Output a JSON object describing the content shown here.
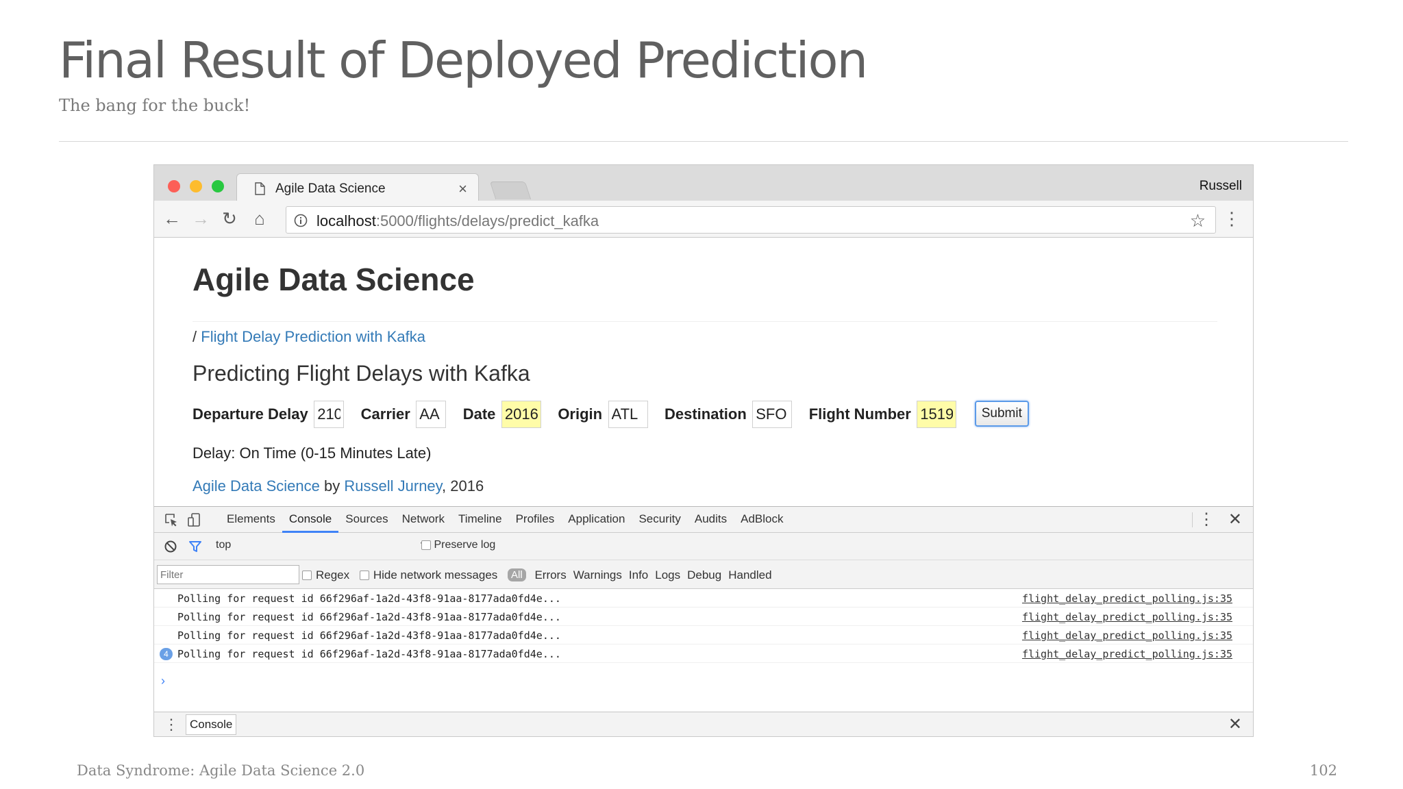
{
  "slide": {
    "title": "Final Result of Deployed Prediction",
    "subtitle": "The bang for the buck!",
    "footer": "Data Syndrome: Agile Data Science 2.0",
    "page_number": "102"
  },
  "browser": {
    "tab_title": "Agile Data Science",
    "profile": "Russell",
    "url_host": "localhost",
    "url_path": ":5000/flights/delays/predict_kafka"
  },
  "page": {
    "heading": "Agile Data Science",
    "breadcrumb_sep": "/",
    "breadcrumb_link": "Flight Delay Prediction with Kafka",
    "subheading": "Predicting Flight Delays with Kafka",
    "form": {
      "departure_delay_label": "Departure Delay",
      "departure_delay_value": "210",
      "carrier_label": "Carrier",
      "carrier_value": "AA",
      "date_label": "Date",
      "date_value": "2016",
      "origin_label": "Origin",
      "origin_value": "ATL",
      "destination_label": "Destination",
      "destination_value": "SFO",
      "flight_number_label": "Flight Number",
      "flight_number_value": "1519",
      "submit_label": "Submit"
    },
    "result": "Delay: On Time (0-15 Minutes Late)",
    "credits": {
      "book_link": "Agile Data Science",
      "by": "by",
      "author_link": "Russell Jurney",
      "year": ", 2016"
    }
  },
  "devtools": {
    "tabs": [
      "Elements",
      "Console",
      "Sources",
      "Network",
      "Timeline",
      "Profiles",
      "Application",
      "Security",
      "Audits",
      "AdBlock"
    ],
    "active_tab": "Console",
    "context": "top",
    "preserve_log": "Preserve log",
    "filter_placeholder": "Filter",
    "regex": "Regex",
    "hide_network": "Hide network messages",
    "all_level": "All",
    "levels": [
      "Errors",
      "Warnings",
      "Info",
      "Logs",
      "Debug",
      "Handled"
    ],
    "log": [
      {
        "message": "Polling for request id 66f296af-1a2d-43f8-91aa-8177ada0fd4e...",
        "source": "flight_delay_predict_polling.js:35",
        "badge": ""
      },
      {
        "message": "Polling for request id 66f296af-1a2d-43f8-91aa-8177ada0fd4e...",
        "source": "flight_delay_predict_polling.js:35",
        "badge": ""
      },
      {
        "message": "Polling for request id 66f296af-1a2d-43f8-91aa-8177ada0fd4e...",
        "source": "flight_delay_predict_polling.js:35",
        "badge": ""
      },
      {
        "message": "Polling for request id 66f296af-1a2d-43f8-91aa-8177ada0fd4e...",
        "source": "flight_delay_predict_polling.js:35",
        "badge": "4"
      }
    ],
    "prompt": "›",
    "drawer_tab": "Console"
  },
  "colors": {
    "link": "#337ab7",
    "highlight": "#fffca8",
    "devtools_active": "#3e82f7"
  }
}
